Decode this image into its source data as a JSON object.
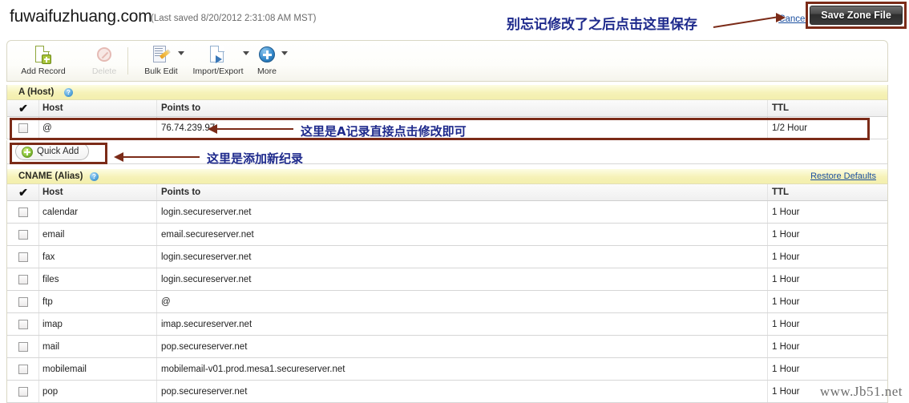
{
  "header": {
    "domain": "fuwaifuzhuang.com",
    "last_saved": "(Last saved 8/20/2012 2:31:08 AM MST)",
    "cancel_label": "Cancel",
    "save_label": "Save Zone File"
  },
  "toolbar": {
    "items": [
      {
        "label": "Add Record",
        "icon": "add-record-icon",
        "disabled": false,
        "has_caret": false
      },
      {
        "label": "Delete",
        "icon": "delete-icon",
        "disabled": true,
        "has_caret": false
      },
      {
        "label": "Bulk Edit",
        "icon": "bulk-edit-icon",
        "disabled": false,
        "has_caret": true
      },
      {
        "label": "Import/Export",
        "icon": "import-export-icon",
        "disabled": false,
        "has_caret": true
      },
      {
        "label": "More",
        "icon": "more-icon",
        "disabled": false,
        "has_caret": true
      }
    ]
  },
  "sections": {
    "a_host": {
      "title": "A (Host)",
      "help_icon": "help-icon",
      "columns": [
        "Host",
        "Points to",
        "TTL"
      ],
      "rows": [
        {
          "host": "@",
          "points_to": "76.74.239.97",
          "ttl": "1/2 Hour"
        }
      ],
      "quick_add_label": "Quick Add"
    },
    "cname": {
      "title": "CNAME (Alias)",
      "help_icon": "help-icon",
      "restore_label": "Restore Defaults",
      "columns": [
        "Host",
        "Points to",
        "TTL"
      ],
      "rows": [
        {
          "host": "calendar",
          "points_to": "login.secureserver.net",
          "ttl": "1 Hour"
        },
        {
          "host": "email",
          "points_to": "email.secureserver.net",
          "ttl": "1 Hour"
        },
        {
          "host": "fax",
          "points_to": "login.secureserver.net",
          "ttl": "1 Hour"
        },
        {
          "host": "files",
          "points_to": "login.secureserver.net",
          "ttl": "1 Hour"
        },
        {
          "host": "ftp",
          "points_to": "@",
          "ttl": "1 Hour"
        },
        {
          "host": "imap",
          "points_to": "imap.secureserver.net",
          "ttl": "1 Hour"
        },
        {
          "host": "mail",
          "points_to": "pop.secureserver.net",
          "ttl": "1 Hour"
        },
        {
          "host": "mobilemail",
          "points_to": "mobilemail-v01.prod.mesa1.secureserver.net",
          "ttl": "1 Hour"
        },
        {
          "host": "pop",
          "points_to": "pop.secureserver.net",
          "ttl": "1 Hour"
        }
      ]
    }
  },
  "annotations": {
    "save_note": "别忘记修改了之后点击这里保存",
    "a_record_note": "这里是A记录直接点击修改即可",
    "quick_add_note": "这里是添加新纪录"
  },
  "watermark": "www.Jb51.net",
  "colors": {
    "annotation_text": "#1e2a8c",
    "annotation_box": "#7b2b18",
    "link": "#1b4fa0",
    "section_bar": "#f3efad"
  }
}
